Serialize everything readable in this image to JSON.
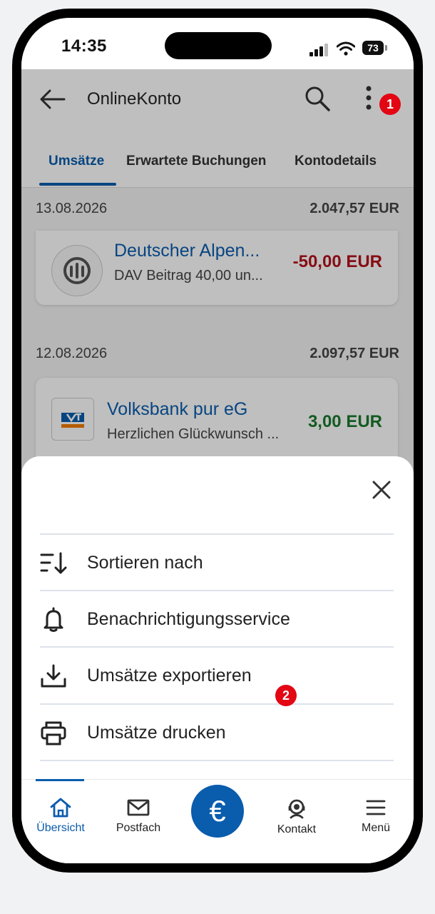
{
  "status_bar": {
    "time": "14:35",
    "battery": "73"
  },
  "header": {
    "title": "OnlineKonto",
    "tabs": [
      {
        "label": "Umsätze",
        "active": true
      },
      {
        "label": "Erwartete Buchungen",
        "active": false
      },
      {
        "label": "Kontodetails",
        "active": false
      }
    ]
  },
  "groups": [
    {
      "date": "13.08.2026",
      "balance": "2.047,57 EUR",
      "transactions": [
        {
          "name": "Deutscher Alpen...",
          "description": "DAV Beitrag 40,00 un...",
          "amount": "-50,00 EUR",
          "sign": "negative"
        }
      ]
    },
    {
      "date": "12.08.2026",
      "balance": "2.097,57 EUR",
      "transactions": [
        {
          "name": "Volksbank pur eG",
          "description": "Herzlichen Glückwunsch ...",
          "amount": "3,00 EUR",
          "sign": "positive"
        }
      ]
    }
  ],
  "sheet": {
    "items": [
      {
        "label": "Sortieren nach",
        "icon": "sort-icon"
      },
      {
        "label": "Benachrichtigungsservice",
        "icon": "bell-icon"
      },
      {
        "label": "Umsätze exportieren",
        "icon": "download-icon"
      },
      {
        "label": "Umsätze drucken",
        "icon": "printer-icon"
      }
    ]
  },
  "bottom_nav": {
    "items": [
      {
        "label": "Übersicht",
        "icon": "home-icon",
        "active": true
      },
      {
        "label": "Postfach",
        "icon": "mail-icon",
        "active": false
      },
      {
        "label": "€",
        "icon": "euro-icon",
        "active": false
      },
      {
        "label": "Kontakt",
        "icon": "headset-icon",
        "active": false
      },
      {
        "label": "Menü",
        "icon": "hamburger-icon",
        "active": false
      }
    ]
  },
  "annotations": [
    "1",
    "2"
  ],
  "colors": {
    "accent": "#0a5cad",
    "negative": "#b5121b",
    "positive": "#1a7a2c",
    "badge": "#e30613"
  }
}
